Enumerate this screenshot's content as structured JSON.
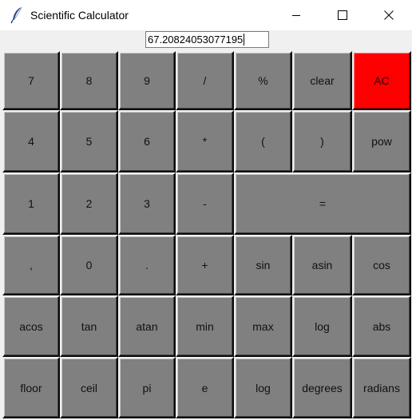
{
  "window": {
    "title": "Scientific Calculator",
    "controls": [
      "minimize-button",
      "maximize-button",
      "close-button"
    ]
  },
  "display": {
    "value": "67.20824053077195"
  },
  "colors": {
    "key_bg": "#808080",
    "clear_all_bg": "#ff0000",
    "window_bg": "#f0f0f0"
  },
  "keys": {
    "k7": "7",
    "k8": "8",
    "k9": "9",
    "divide": "/",
    "percent": "%",
    "clear": "clear",
    "all_clear": "AC",
    "k4": "4",
    "k5": "5",
    "k6": "6",
    "multiply": "*",
    "lparen": "(",
    "rparen": ")",
    "pow": "pow",
    "k1": "1",
    "k2": "2",
    "k3": "3",
    "minus": "-",
    "equals": "=",
    "comma": ",",
    "k0": "0",
    "dot": ".",
    "plus": "+",
    "sin": "sin",
    "asin": "asin",
    "cos": "cos",
    "acos": "acos",
    "tan": "tan",
    "atan": "atan",
    "min": "min",
    "max": "max",
    "log1": "log",
    "abs": "abs",
    "floor": "floor",
    "ceil": "ceil",
    "pi": "pi",
    "e": "e",
    "log2": "log",
    "degrees": "degrees",
    "radians": "radians"
  }
}
